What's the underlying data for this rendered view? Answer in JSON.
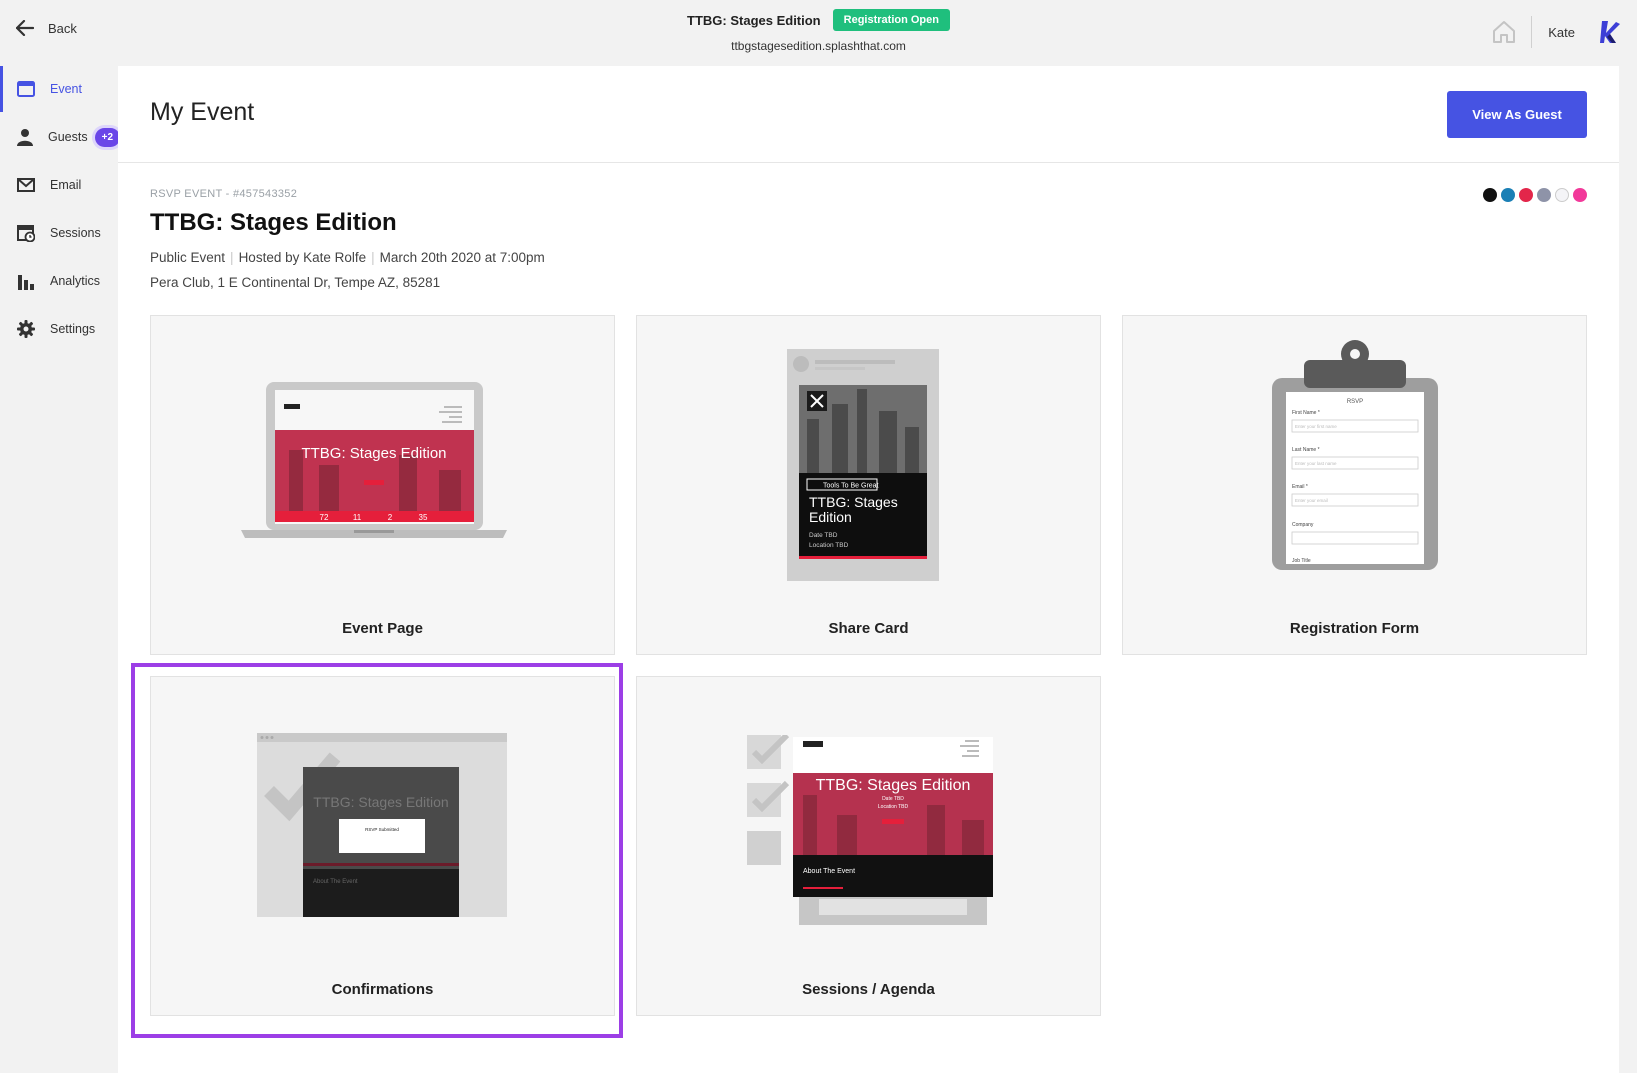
{
  "topbar": {
    "back_label": "Back",
    "event_name": "TTBG: Stages Edition",
    "registration_badge": "Registration Open",
    "event_url": "ttbgstagesedition.splashthat.com",
    "user_name": "Kate"
  },
  "sidebar": {
    "items": [
      {
        "label": "Event",
        "icon": "layout-icon"
      },
      {
        "label": "Guests",
        "icon": "person-icon",
        "badge": "+2"
      },
      {
        "label": "Email",
        "icon": "mail-icon"
      },
      {
        "label": "Sessions",
        "icon": "calendar-clock-icon"
      },
      {
        "label": "Analytics",
        "icon": "bar-chart-icon"
      },
      {
        "label": "Settings",
        "icon": "gear-icon"
      }
    ]
  },
  "header": {
    "title": "My Event",
    "view_as_guest": "View As Guest"
  },
  "event": {
    "type_id": "RSVP EVENT - #457543352",
    "title": "TTBG: Stages Edition",
    "visibility": "Public Event",
    "host": "Hosted by Kate Rolfe",
    "datetime": "March 20th 2020 at 7:00pm",
    "address": "Pera Club, 1 E Continental Dr, Tempe AZ, 85281",
    "theme_colors": [
      "#111111",
      "#1a7fb5",
      "#e3264a",
      "#8e93a8",
      "#f4f4f7",
      "#f2399a"
    ]
  },
  "cards": [
    {
      "label": "Event Page"
    },
    {
      "label": "Share Card"
    },
    {
      "label": "Registration Form"
    },
    {
      "label": "Confirmations"
    },
    {
      "label": "Sessions / Agenda"
    }
  ],
  "previews": {
    "event_page": {
      "title": "TTBG: Stages Edition",
      "countdown": [
        "72",
        "11",
        "2",
        "35"
      ]
    },
    "share_card": {
      "brand": "Tools To Be Great",
      "title_line1": "TTBG: Stages",
      "title_line2": "Edition",
      "date": "Date TBD",
      "location": "Location TBD"
    },
    "registration_form": {
      "heading": "RSVP",
      "fields": [
        {
          "label": "First Name *",
          "placeholder": "Enter your first name"
        },
        {
          "label": "Last Name *",
          "placeholder": "Enter your last name"
        },
        {
          "label": "Email *",
          "placeholder": "Enter your email"
        },
        {
          "label": "Company",
          "placeholder": ""
        }
      ],
      "next_field": "Job Title"
    },
    "confirmations": {
      "title": "TTBG: Stages Edition",
      "modal_text": "RSVP Submitted",
      "section": "About The Event"
    },
    "sessions": {
      "title": "TTBG: Stages Edition",
      "subtitle": "Date TBD",
      "subtitle2": "Location TBD",
      "section": "About The Event"
    }
  }
}
